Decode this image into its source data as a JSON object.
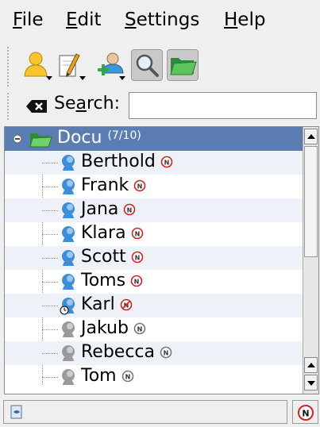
{
  "menubar": {
    "file": {
      "mnemonic": "F",
      "rest": "ile"
    },
    "edit": {
      "mnemonic": "E",
      "rest": "dit"
    },
    "settings": {
      "mnemonic": "S",
      "rest": "ettings"
    },
    "help": {
      "mnemonic": "H",
      "rest": "elp"
    }
  },
  "toolbar": {
    "buttons": [
      "status-menu-icon",
      "edit-menu-icon",
      "add-contact-icon",
      "search-toggle-icon",
      "folder-toggle-icon"
    ],
    "active": [
      "search-toggle-icon",
      "folder-toggle-icon"
    ]
  },
  "search": {
    "label_before": "Se",
    "label_mnemonic": "a",
    "label_after": "rch:",
    "value": "",
    "placeholder": ""
  },
  "group": {
    "name": "Docu",
    "count": "(7/10)",
    "color": "#5b7db1"
  },
  "contacts": [
    {
      "name": "Berthold",
      "status": "online"
    },
    {
      "name": "Frank",
      "status": "online"
    },
    {
      "name": "Jana",
      "status": "online"
    },
    {
      "name": "Klara",
      "status": "online"
    },
    {
      "name": "Scott",
      "status": "online"
    },
    {
      "name": "Toms",
      "status": "online"
    },
    {
      "name": "Karl",
      "status": "away"
    },
    {
      "name": "Jakub",
      "status": "offline"
    },
    {
      "name": "Rebecca",
      "status": "offline"
    },
    {
      "name": "Tom",
      "status": "offline"
    }
  ],
  "colors": {
    "selection": "#5b7db1",
    "alt_row": "#eef2f8",
    "online_head": "#3d8fd8",
    "offline_head": "#9a9a9a",
    "network_badge": "#d62020"
  }
}
